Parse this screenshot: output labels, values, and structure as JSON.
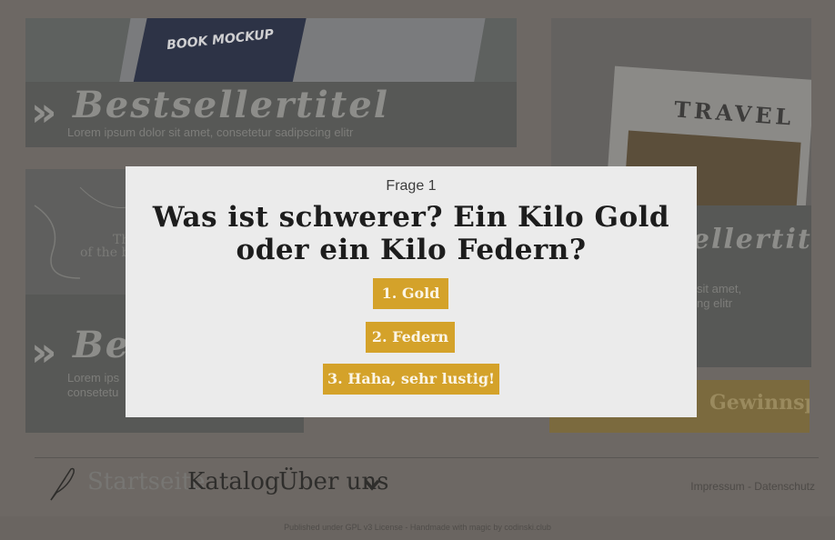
{
  "background": {
    "tile_top": {
      "mockup_label": "BOOK MOCKUP",
      "title": "Bestsellertitel",
      "text": "Lorem ipsum dolor sit amet, consetetur sadipscing elitr"
    },
    "tile_left": {
      "title": "Best",
      "text_line1": "Lorem ips",
      "text_line2": "consetetu",
      "map_text_1": "Th",
      "map_text_2": "of the b"
    },
    "tile_right": {
      "book_title": "TRAVEL",
      "title": "sellertitel",
      "text_line1": "sit amet,",
      "text_line2": "ng elitr"
    },
    "tile_gold": {
      "text": "Gewinnspiel!"
    }
  },
  "footer": {
    "nav": {
      "home": "Startseite",
      "catalog": "Katalog",
      "about": "Über uns"
    },
    "legal": "Impressum - Datenschutz",
    "published": "Published under GPL v3 License - Handmade with magic by codinski.club"
  },
  "quiz": {
    "question_number": "Frage 1",
    "question": "Was ist schwerer? Ein Kilo Gold oder ein Kilo Federn?",
    "answers": [
      "1. Gold",
      "2. Federn",
      "3. Haha, sehr lustig!"
    ]
  },
  "colors": {
    "answer_button": "#d4a22a",
    "modal_background": "#ebebeb"
  }
}
